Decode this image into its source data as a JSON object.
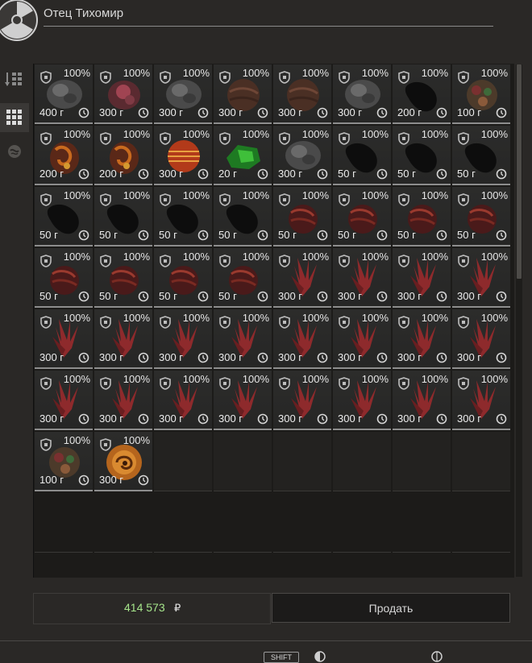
{
  "trader": {
    "name": "Отец Тихомир"
  },
  "colors": {
    "accent_green": "#a6e58b",
    "text": "#cfcfcf"
  },
  "side_tabs": [
    {
      "name": "sorted-list-tab",
      "icon": "sorted-list-icon",
      "active": false
    },
    {
      "name": "grid-view-tab",
      "icon": "grid-icon",
      "active": true
    },
    {
      "name": "artifact-filter-tab",
      "icon": "artifact-icon",
      "active": false
    }
  ],
  "inventory": {
    "items": [
      {
        "condition": "100%",
        "weight": "400 г",
        "art": "grey-rock"
      },
      {
        "condition": "100%",
        "weight": "300 г",
        "art": "pink-bloom"
      },
      {
        "condition": "100%",
        "weight": "300 г",
        "art": "grey-rock"
      },
      {
        "condition": "100%",
        "weight": "300 г",
        "art": "brown-orb"
      },
      {
        "condition": "100%",
        "weight": "300 г",
        "art": "brown-orb"
      },
      {
        "condition": "100%",
        "weight": "300 г",
        "art": "grey-rock"
      },
      {
        "condition": "100%",
        "weight": "200 г",
        "art": "black-mass"
      },
      {
        "condition": "100%",
        "weight": "100 г",
        "art": "flower-mix"
      },
      {
        "condition": "100%",
        "weight": "200 г",
        "art": "flame-spiral"
      },
      {
        "condition": "100%",
        "weight": "200 г",
        "art": "flame-spiral"
      },
      {
        "condition": "100%",
        "weight": "300 г",
        "art": "red-striped-orb"
      },
      {
        "condition": "100%",
        "weight": "20 г",
        "art": "green-crystal"
      },
      {
        "condition": "100%",
        "weight": "300 г",
        "art": "grey-rock"
      },
      {
        "condition": "100%",
        "weight": "50 г",
        "art": "black-mass"
      },
      {
        "condition": "100%",
        "weight": "50 г",
        "art": "black-mass"
      },
      {
        "condition": "100%",
        "weight": "50 г",
        "art": "black-mass"
      },
      {
        "condition": "100%",
        "weight": "50 г",
        "art": "black-mass"
      },
      {
        "condition": "100%",
        "weight": "50 г",
        "art": "black-mass"
      },
      {
        "condition": "100%",
        "weight": "50 г",
        "art": "black-mass"
      },
      {
        "condition": "100%",
        "weight": "50 г",
        "art": "black-mass"
      },
      {
        "condition": "100%",
        "weight": "50 г",
        "art": "red-shell"
      },
      {
        "condition": "100%",
        "weight": "50 г",
        "art": "red-shell"
      },
      {
        "condition": "100%",
        "weight": "50 г",
        "art": "red-shell"
      },
      {
        "condition": "100%",
        "weight": "50 г",
        "art": "red-shell"
      },
      {
        "condition": "100%",
        "weight": "50 г",
        "art": "red-shell"
      },
      {
        "condition": "100%",
        "weight": "50 г",
        "art": "red-shell"
      },
      {
        "condition": "100%",
        "weight": "50 г",
        "art": "red-shell"
      },
      {
        "condition": "100%",
        "weight": "50 г",
        "art": "red-shell"
      },
      {
        "condition": "100%",
        "weight": "300 г",
        "art": "red-crystal"
      },
      {
        "condition": "100%",
        "weight": "300 г",
        "art": "red-crystal"
      },
      {
        "condition": "100%",
        "weight": "300 г",
        "art": "red-crystal"
      },
      {
        "condition": "100%",
        "weight": "300 г",
        "art": "red-crystal"
      },
      {
        "condition": "100%",
        "weight": "300 г",
        "art": "red-crystal"
      },
      {
        "condition": "100%",
        "weight": "300 г",
        "art": "red-crystal"
      },
      {
        "condition": "100%",
        "weight": "300 г",
        "art": "red-crystal"
      },
      {
        "condition": "100%",
        "weight": "300 г",
        "art": "red-crystal"
      },
      {
        "condition": "100%",
        "weight": "300 г",
        "art": "red-crystal"
      },
      {
        "condition": "100%",
        "weight": "300 г",
        "art": "red-crystal"
      },
      {
        "condition": "100%",
        "weight": "300 г",
        "art": "red-crystal"
      },
      {
        "condition": "100%",
        "weight": "300 г",
        "art": "red-crystal"
      },
      {
        "condition": "100%",
        "weight": "300 г",
        "art": "red-crystal"
      },
      {
        "condition": "100%",
        "weight": "300 г",
        "art": "red-crystal"
      },
      {
        "condition": "100%",
        "weight": "300 г",
        "art": "red-crystal"
      },
      {
        "condition": "100%",
        "weight": "300 г",
        "art": "red-crystal"
      },
      {
        "condition": "100%",
        "weight": "300 г",
        "art": "red-crystal"
      },
      {
        "condition": "100%",
        "weight": "300 г",
        "art": "red-crystal"
      },
      {
        "condition": "100%",
        "weight": "300 г",
        "art": "red-crystal"
      },
      {
        "condition": "100%",
        "weight": "300 г",
        "art": "red-crystal"
      },
      {
        "condition": "100%",
        "weight": "100 г",
        "art": "flower-mix"
      },
      {
        "condition": "100%",
        "weight": "300 г",
        "art": "orange-swirl"
      }
    ]
  },
  "footer": {
    "total_amount": "414 573",
    "currency_symbol": "₽",
    "sell_label": "Продать",
    "shift_key_label": "SHIFT"
  }
}
